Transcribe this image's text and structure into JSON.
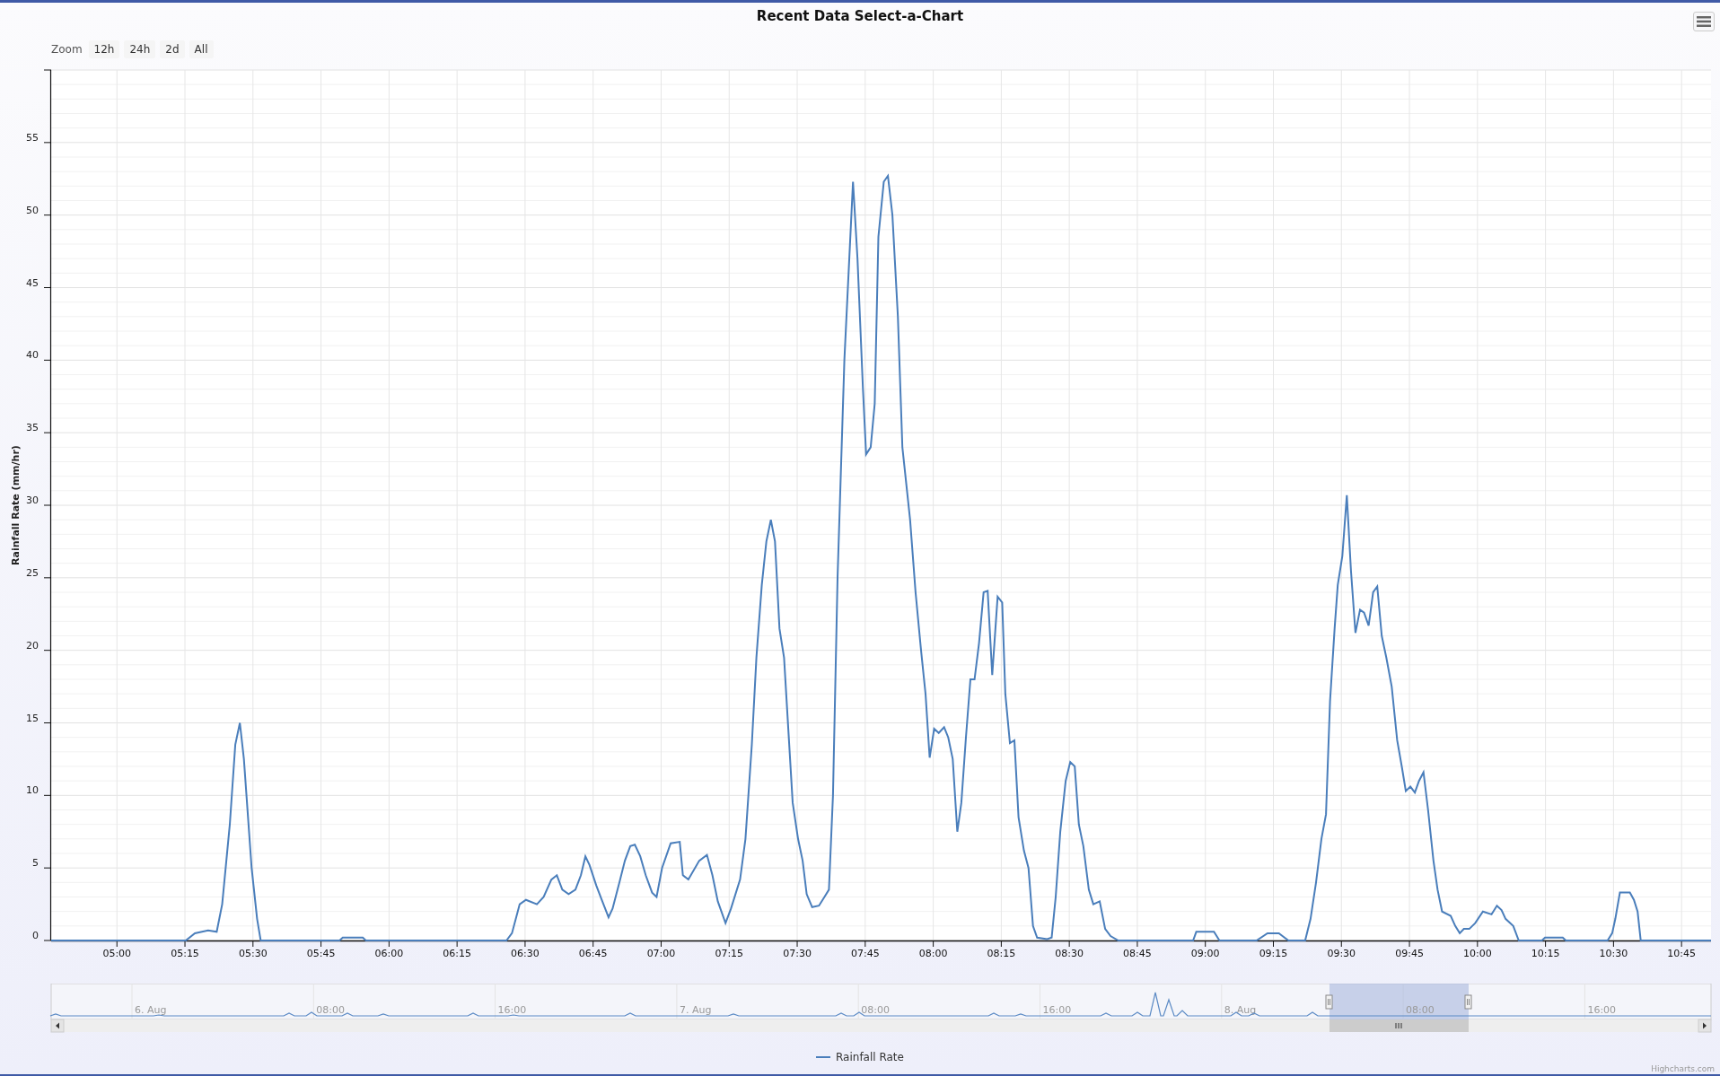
{
  "title": "Recent Data Select-a-Chart",
  "range_selector": {
    "label": "Zoom",
    "buttons": [
      {
        "label": "12h",
        "selected": false
      },
      {
        "label": "24h",
        "selected": false
      },
      {
        "label": "2d",
        "selected": false
      },
      {
        "label": "All",
        "selected": false
      }
    ]
  },
  "chart": {
    "chart_data": {
      "type": "line",
      "grid": true,
      "ylabel": "Rainfall Rate (mm/hr)",
      "xlim": [
        285.5,
        651.5
      ],
      "ylim": [
        0,
        60
      ],
      "yticks": [
        0,
        5,
        10,
        15,
        20,
        25,
        30,
        35,
        40,
        45,
        50,
        55
      ],
      "xticks": [
        {
          "value": 300,
          "label": "05:00"
        },
        {
          "value": 315,
          "label": "05:15"
        },
        {
          "value": 330,
          "label": "05:30"
        },
        {
          "value": 345,
          "label": "05:45"
        },
        {
          "value": 360,
          "label": "06:00"
        },
        {
          "value": 375,
          "label": "06:15"
        },
        {
          "value": 390,
          "label": "06:30"
        },
        {
          "value": 405,
          "label": "06:45"
        },
        {
          "value": 420,
          "label": "07:00"
        },
        {
          "value": 435,
          "label": "07:15"
        },
        {
          "value": 450,
          "label": "07:30"
        },
        {
          "value": 465,
          "label": "07:45"
        },
        {
          "value": 480,
          "label": "08:00"
        },
        {
          "value": 495,
          "label": "08:15"
        },
        {
          "value": 510,
          "label": "08:30"
        },
        {
          "value": 525,
          "label": "08:45"
        },
        {
          "value": 540,
          "label": "09:00"
        },
        {
          "value": 555,
          "label": "09:15"
        },
        {
          "value": 570,
          "label": "09:30"
        },
        {
          "value": 585,
          "label": "09:45"
        },
        {
          "value": 600,
          "label": "10:00"
        },
        {
          "value": 615,
          "label": "10:15"
        },
        {
          "value": 630,
          "label": "10:30"
        },
        {
          "value": 645,
          "label": "10:45"
        }
      ],
      "x": [
        285.5,
        315.2,
        317.2,
        320.1,
        322.0,
        323.2,
        324.9,
        326.1,
        327.1,
        328.0,
        329.7,
        330.9,
        331.7,
        349.1,
        349.8,
        354.2,
        354.9,
        385.9,
        387.1,
        388.8,
        390.2,
        392.6,
        394.1,
        395.8,
        397.0,
        398.2,
        399.6,
        401.1,
        402.3,
        403.3,
        404.2,
        405.7,
        406.9,
        408.4,
        409.3,
        410.8,
        412.0,
        413.2,
        414.2,
        415.4,
        416.6,
        418.0,
        419.0,
        420.2,
        422.1,
        424.1,
        424.8,
        426.0,
        428.4,
        430.1,
        431.3,
        432.5,
        434.2,
        435.4,
        437.4,
        438.6,
        440.0,
        441.0,
        442.2,
        443.2,
        444.2,
        445.1,
        446.1,
        447.1,
        449.0,
        450.2,
        451.2,
        452.1,
        453.3,
        454.8,
        456.0,
        457.0,
        457.9,
        458.9,
        460.4,
        462.3,
        463.3,
        464.5,
        465.2,
        466.2,
        467.1,
        467.9,
        469.1,
        470.0,
        471.0,
        472.2,
        473.2,
        474.9,
        476.1,
        477.3,
        478.3,
        479.2,
        480.2,
        481.2,
        482.4,
        483.3,
        484.3,
        485.3,
        486.2,
        487.2,
        488.2,
        489.1,
        490.1,
        491.1,
        492.0,
        493.0,
        494.2,
        495.2,
        495.9,
        496.9,
        497.9,
        498.8,
        500.0,
        501.0,
        502.0,
        502.9,
        505.1,
        506.1,
        507.0,
        508.0,
        509.2,
        510.2,
        511.2,
        512.1,
        513.1,
        514.3,
        515.3,
        516.7,
        517.9,
        519.1,
        520.8,
        537.3,
        538.0,
        541.9,
        543.1,
        551.3,
        553.7,
        556.2,
        558.3,
        562.0,
        563.2,
        564.4,
        565.6,
        566.6,
        567.5,
        568.5,
        569.2,
        570.2,
        571.2,
        572.1,
        573.1,
        574.1,
        575.0,
        576.0,
        577.0,
        577.9,
        578.9,
        579.9,
        581.1,
        582.3,
        583.3,
        584.2,
        585.2,
        586.2,
        587.1,
        588.1,
        589.1,
        590.3,
        591.2,
        592.2,
        594.1,
        595.1,
        596.1,
        597.0,
        598.2,
        599.5,
        601.2,
        603.1,
        604.3,
        605.3,
        606.2,
        607.9,
        609.1,
        614.2,
        614.9,
        618.8,
        619.5,
        628.7,
        629.7,
        630.4,
        631.4,
        633.6,
        634.5,
        635.3,
        636.0,
        651.5
      ],
      "series": [
        {
          "name": "Rainfall Rate",
          "color": "#4a7ebb",
          "values": [
            0,
            0,
            0.5,
            0.7,
            0.6,
            2.5,
            8,
            13.5,
            15,
            12.5,
            5,
            1.5,
            0,
            0,
            0.2,
            0.2,
            0,
            0,
            0.5,
            2.5,
            2.8,
            2.5,
            3,
            4.2,
            4.5,
            3.5,
            3.2,
            3.5,
            4.5,
            5.8,
            5.2,
            3.8,
            2.8,
            1.6,
            2.2,
            4,
            5.5,
            6.5,
            6.6,
            5.8,
            4.5,
            3.3,
            3,
            5,
            6.7,
            6.8,
            4.5,
            4.2,
            5.5,
            5.9,
            4.5,
            2.7,
            1.2,
            2.2,
            4.2,
            7,
            13.5,
            19.5,
            24.5,
            27.5,
            29,
            27.5,
            21.5,
            19.5,
            9.5,
            7,
            5.5,
            3.2,
            2.3,
            2.4,
            3,
            3.5,
            10,
            25,
            40,
            52.3,
            47,
            38,
            33.5,
            34,
            37,
            48.5,
            52.3,
            52.7,
            50,
            43,
            34,
            29,
            24,
            20,
            17,
            12.6,
            14.6,
            14.3,
            14.7,
            14,
            12.5,
            7.5,
            9.5,
            14,
            18,
            18,
            20.5,
            24,
            24.1,
            18.3,
            23.7,
            23.3,
            17,
            13.6,
            13.8,
            8.5,
            6.2,
            5,
            1,
            0.2,
            0.1,
            0.2,
            3,
            7.5,
            11,
            12.3,
            12,
            8,
            6.5,
            3.5,
            2.5,
            2.7,
            0.8,
            0.3,
            0,
            0,
            0.6,
            0.6,
            0,
            0,
            0.5,
            0.5,
            0,
            0,
            1.5,
            4,
            7,
            8.7,
            16.5,
            21.5,
            24.5,
            26.5,
            30.7,
            25.5,
            21.2,
            22.8,
            22.6,
            21.7,
            24,
            24.4,
            21,
            19.5,
            17.5,
            13.8,
            12,
            10.3,
            10.6,
            10.2,
            11,
            11.6,
            9,
            5.5,
            3.5,
            2,
            1.7,
            1,
            0.5,
            0.8,
            0.8,
            1.2,
            2,
            1.8,
            2.4,
            2.1,
            1.5,
            1,
            0,
            0,
            0.2,
            0.2,
            0,
            0,
            0.5,
            1.5,
            3.3,
            3.3,
            2.8,
            2,
            0,
            0
          ]
        }
      ]
    }
  },
  "navigator": {
    "labels": [
      "6. Aug",
      "08:00",
      "16:00",
      "7. Aug",
      "08:00",
      "16:00",
      "8. Aug",
      "08:00",
      "16:00"
    ]
  },
  "credits": "Highcharts.com"
}
